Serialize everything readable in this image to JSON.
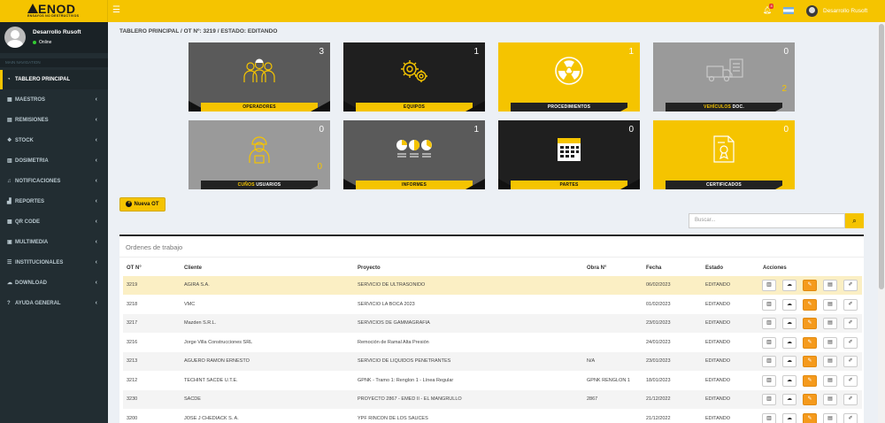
{
  "app": {
    "logo_text": "ENOD",
    "logo_tagline": "ENSAYOS NO DESTRUCTIVOS"
  },
  "topbar": {
    "notification_count": "4",
    "user_name": "Desarrollo Rusoft"
  },
  "sidebar": {
    "user_name": "Desarrollo Rusoft",
    "user_status": "Online",
    "header": "MAIN NAVIGATION",
    "items": [
      {
        "label": "TABLERO PRINCIPAL",
        "icon": "dashboard-icon",
        "chevron": ""
      },
      {
        "label": "MAESTROS",
        "icon": "grid-icon",
        "chevron": "‹"
      },
      {
        "label": "REMISIONES",
        "icon": "document-icon",
        "chevron": "‹"
      },
      {
        "label": "STOCK",
        "icon": "cubes-icon",
        "chevron": "‹"
      },
      {
        "label": "DOSIMETRIA",
        "icon": "chart-icon",
        "chevron": "‹"
      },
      {
        "label": "NOTIFICACIONES",
        "icon": "bell-icon",
        "chevron": "‹"
      },
      {
        "label": "REPORTES",
        "icon": "bar-chart-icon",
        "chevron": "‹"
      },
      {
        "label": "QR CODE",
        "icon": "qrcode-icon",
        "chevron": "‹"
      },
      {
        "label": "MULTIMEDIA",
        "icon": "film-icon",
        "chevron": "‹"
      },
      {
        "label": "INSTITUCIONALES",
        "icon": "list-icon",
        "chevron": "‹"
      },
      {
        "label": "DOWNLOAD",
        "icon": "cloud-download-icon",
        "chevron": "‹"
      },
      {
        "label": "AYUDA GENERAL",
        "icon": "question-icon",
        "chevron": "‹"
      }
    ]
  },
  "breadcrumb": "TABLERO PRINCIPAL / OT Nº: 3219 / ESTADO: EDITANDO",
  "cards": [
    {
      "label": "OPERADORES",
      "label_accent": "",
      "count": "3",
      "count2": "",
      "style": "dark",
      "icon": "operators-icon"
    },
    {
      "label": "EQUIPOS",
      "label_accent": "",
      "count": "1",
      "count2": "",
      "style": "black",
      "icon": "gears-icon"
    },
    {
      "label": "PROCEDIMIENTOS",
      "label_accent": "",
      "count": "1",
      "count2": "",
      "style": "yellow",
      "icon": "radiation-icon"
    },
    {
      "label": "DOC.",
      "label_accent": "VEHÍCULOS",
      "count": "0",
      "count2": "2",
      "style": "grey",
      "icon": "truck-doc-icon"
    },
    {
      "label": "USUARIOS",
      "label_accent": "CUÑOS",
      "count": "0",
      "count2": "0",
      "style": "grey",
      "icon": "worker-icon"
    },
    {
      "label": "INFORMES",
      "label_accent": "",
      "count": "1",
      "count2": "",
      "style": "dark",
      "icon": "pie-charts-icon"
    },
    {
      "label": "PARTES",
      "label_accent": "",
      "count": "0",
      "count2": "",
      "style": "black",
      "icon": "calendar-icon"
    },
    {
      "label": "CERTIFICADOS",
      "label_accent": "",
      "count": "0",
      "count2": "",
      "style": "yellow",
      "icon": "certificate-icon"
    }
  ],
  "new_ot_label": "Nueva OT",
  "search": {
    "placeholder": "Buscar..."
  },
  "panel": {
    "title": "Ordenes de trabajo"
  },
  "table": {
    "headers": [
      "OT N°",
      "Cliente",
      "Proyecto",
      "Obra N°",
      "Fecha",
      "Estado",
      "Acciones"
    ],
    "rows": [
      {
        "ot": "3219",
        "cliente": "AGIRA S.A.",
        "proyecto": "SERVICIO DE ULTRASONIDO",
        "obra": "",
        "fecha": "06/02/2023",
        "estado": "EDITANDO"
      },
      {
        "ot": "3218",
        "cliente": "VMC",
        "proyecto": "SERVICIO LA BOCA 2023",
        "obra": "",
        "fecha": "01/02/2023",
        "estado": "EDITANDO"
      },
      {
        "ot": "3217",
        "cliente": "Mazden S.R.L.",
        "proyecto": "SERVICIOS DE GAMMAGRAFIA",
        "obra": "",
        "fecha": "23/01/2023",
        "estado": "EDITANDO"
      },
      {
        "ot": "3216",
        "cliente": "Jorge Villa Construcciones SRL",
        "proyecto": "Remoción de Ramal Alta Presión",
        "obra": "",
        "fecha": "24/01/2023",
        "estado": "EDITANDO"
      },
      {
        "ot": "3213",
        "cliente": "AGUERO RAMON ERNESTO",
        "proyecto": "SERVICIO DE LIQUIDOS PENETRANTES",
        "obra": "N/A",
        "fecha": "23/01/2023",
        "estado": "EDITANDO"
      },
      {
        "ot": "3212",
        "cliente": "TECHINT SACDE U.T.E.",
        "proyecto": "GPNK - Tramo 1: Renglon 1 - Línea Regular",
        "obra": "GPNK RENGLON 1",
        "fecha": "18/01/2023",
        "estado": "EDITANDO"
      },
      {
        "ot": "3230",
        "cliente": "SACDE",
        "proyecto": "PROYECTO 2867 - EMED II - EL MANGRULLO",
        "obra": "2867",
        "fecha": "21/12/2022",
        "estado": "EDITANDO"
      },
      {
        "ot": "3200",
        "cliente": "JOSE J CHEDIACK S. A.",
        "proyecto": "YPF RINCON DE LOS SAUCES",
        "obra": "",
        "fecha": "21/12/2022",
        "estado": "EDITANDO"
      }
    ]
  },
  "colors": {
    "brand": "#f5c400",
    "sidebar": "#222d32",
    "edit_button": "#f59a1c"
  }
}
